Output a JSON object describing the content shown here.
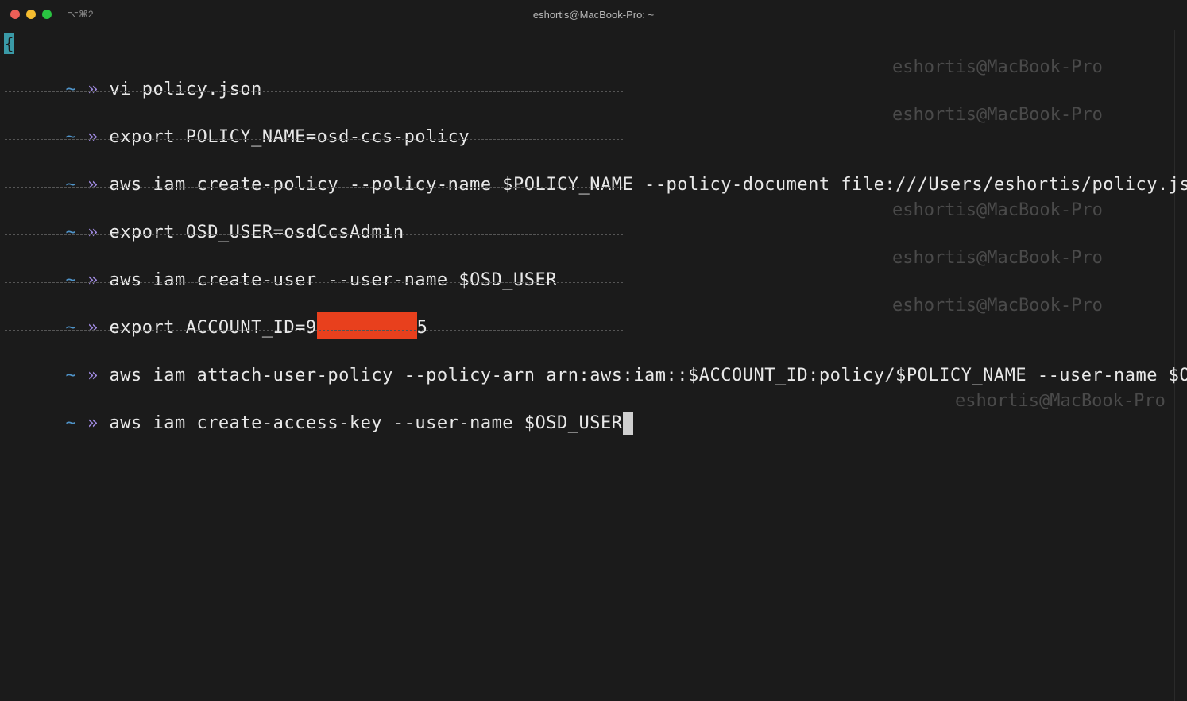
{
  "window": {
    "shortcut": "⌥⌘2",
    "title": "eshortis@MacBook-Pro: ~"
  },
  "terminal": {
    "first_char": "{",
    "prompt_tilde": "~",
    "prompt_arrow": "»",
    "right_prompt": "eshortis@MacBook-Pro",
    "commands": [
      "vi policy.json",
      "export POLICY_NAME=osd-ccs-policy",
      "aws iam create-policy --policy-name $POLICY_NAME --policy-document file:///Users/eshortis/policy.json",
      "export OSD_USER=osdCcsAdmin",
      "aws iam create-user --user-name $OSD_USER",
      "aws iam attach-user-policy --policy-arn arn:aws:iam::$ACCOUNT_ID:policy/$POLICY_NAME --user-name $OSD_USER",
      "aws iam create-access-key --user-name $OSD_USER"
    ],
    "account_cmd_prefix": "export ACCOUNT_ID=9",
    "account_cmd_suffix": "5"
  },
  "colors": {
    "background": "#1b1b1b",
    "prompt_tilde": "#4f93c8",
    "prompt_arrow": "#9d88dd",
    "redaction": "#e8401d"
  }
}
